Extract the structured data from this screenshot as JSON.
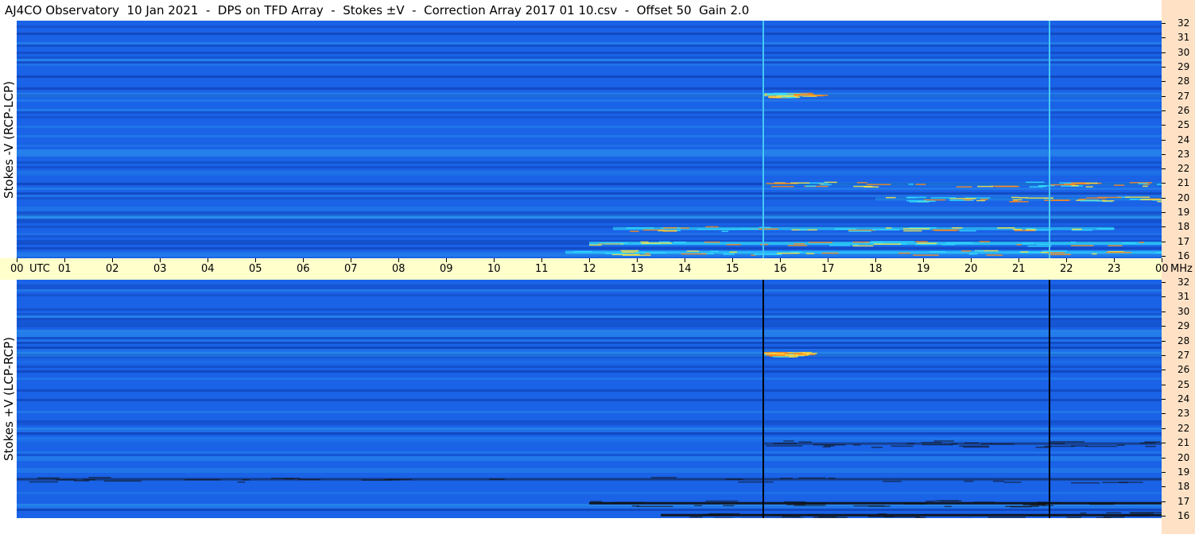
{
  "title": "AJ4CO Observatory  10 Jan 2021  -  DPS on TFD Array  -  Stokes ±V  -  Correction Array 2017 01 10.csv  -  Offset 50  Gain 2.0",
  "colors": {
    "background": "#ffffff",
    "time_axis_bg": "#ffffcc",
    "freq_axis_bg": "#ffe2c6",
    "spectrogram_base": "#1a62e6",
    "spectrogram_dark": "#0c37a6",
    "spectrogram_light": "#2f9cf0",
    "burst_colors": [
      "#31e0ff",
      "#ffe640",
      "#ff8a1a",
      "#111111"
    ]
  },
  "chart_data": [
    {
      "type": "heatmap",
      "name": "top-panel",
      "ylabel": "Stokes -V (RCP-LCP)",
      "xlim": [
        0,
        24
      ],
      "ylim": [
        16,
        32
      ],
      "grid": false,
      "colormap": "blue-cyan-yellow-red",
      "cursor_lines": {
        "hours": [
          15.65,
          21.65
        ],
        "color": "light"
      },
      "features": [
        {
          "x_hours": [
            0,
            24
          ],
          "freq_mhz": 27.0,
          "strength": 0.4,
          "kind": "band"
        },
        {
          "x_hours": [
            15.65,
            16.5
          ],
          "freq_mhz": 27.0,
          "strength": 0.9,
          "kind": "burst"
        },
        {
          "x_hours": [
            12.0,
            24.0
          ],
          "freq_mhz": 17.0,
          "strength": 0.95,
          "kind": "burst"
        },
        {
          "x_hours": [
            11.5,
            24.0
          ],
          "freq_mhz": 16.4,
          "strength": 0.8,
          "kind": "burst"
        },
        {
          "x_hours": [
            12.5,
            23.0
          ],
          "freq_mhz": 18.0,
          "strength": 0.7,
          "kind": "burst"
        },
        {
          "x_hours": [
            0.0,
            24.0
          ],
          "freq_mhz": 18.8,
          "strength": 0.4,
          "kind": "band"
        },
        {
          "x_hours": [
            15.65,
            24.0
          ],
          "freq_mhz": 21.0,
          "strength": 0.3,
          "kind": "burst"
        },
        {
          "x_hours": [
            18.0,
            24.0
          ],
          "freq_mhz": 20.0,
          "strength": 0.3,
          "kind": "burst"
        }
      ]
    },
    {
      "type": "heatmap",
      "name": "bottom-panel",
      "ylabel": "Stokes +V (LCP-RCP)",
      "xlim": [
        0,
        24
      ],
      "ylim": [
        16,
        32
      ],
      "grid": false,
      "colormap": "blue-cyan-yellow-red",
      "cursor_lines": {
        "hours": [
          15.65,
          21.65
        ],
        "color": "dark"
      },
      "features": [
        {
          "x_hours": [
            0,
            24
          ],
          "freq_mhz": 27.0,
          "strength": 0.45,
          "kind": "band"
        },
        {
          "x_hours": [
            15.65,
            16.5
          ],
          "freq_mhz": 27.0,
          "strength": 0.7,
          "kind": "burst"
        },
        {
          "x_hours": [
            12.0,
            24.0
          ],
          "freq_mhz": 17.0,
          "strength": 0.9,
          "kind": "absorption"
        },
        {
          "x_hours": [
            13.5,
            24.0
          ],
          "freq_mhz": 16.2,
          "strength": 0.9,
          "kind": "absorption"
        },
        {
          "x_hours": [
            0.0,
            24.0
          ],
          "freq_mhz": 20.0,
          "strength": 0.4,
          "kind": "band"
        },
        {
          "x_hours": [
            0.0,
            24.0
          ],
          "freq_mhz": 18.6,
          "strength": 0.4,
          "kind": "absorption"
        },
        {
          "x_hours": [
            15.65,
            24.0
          ],
          "freq_mhz": 21.0,
          "strength": 0.4,
          "kind": "absorption"
        }
      ]
    }
  ],
  "time_axis": {
    "utc_label": "UTC",
    "end_unit": "MHz",
    "labels": [
      "00",
      "01",
      "02",
      "03",
      "04",
      "05",
      "06",
      "07",
      "08",
      "09",
      "10",
      "11",
      "12",
      "13",
      "14",
      "15",
      "16",
      "17",
      "18",
      "19",
      "20",
      "21",
      "22",
      "23",
      "00"
    ]
  },
  "freq_axis": {
    "top_labels": [
      "32",
      "31",
      "30",
      "29",
      "28",
      "27",
      "26",
      "25",
      "24",
      "23",
      "22",
      "21",
      "20",
      "19",
      "18",
      "17",
      "16"
    ],
    "bottom_labels": [
      "32",
      "31",
      "30",
      "29",
      "28",
      "27",
      "26",
      "25",
      "24",
      "23",
      "22",
      "21",
      "20",
      "19",
      "18",
      "17",
      "16"
    ]
  }
}
